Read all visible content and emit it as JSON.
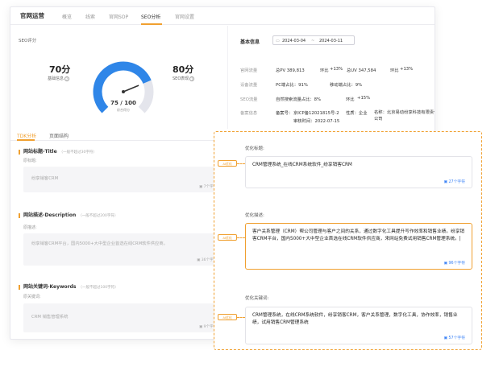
{
  "nav": {
    "brand": "官网运营",
    "tabs": [
      "概览",
      "线索",
      "官网SOP",
      "SEO分析",
      "官网设置"
    ]
  },
  "seo_score": {
    "section_label": "SEO评分",
    "basic_score": "70分",
    "basic_label": "基础信息",
    "gauge_value": "75 / 100",
    "gauge_sub": "综合得分",
    "gauge_fraction": 0.75,
    "seo_score": "80分",
    "seo_label": "SEO表现"
  },
  "basic_info": {
    "header": "基本信息",
    "date_start": "2024-03-04",
    "date_sep": "~",
    "date_end": "2024-03-11",
    "rows": {
      "traffic": {
        "key": "官网流量",
        "pv": "总PV 389,813",
        "pv_chg_lbl": "环比",
        "pv_chg": "+13%",
        "uv": "总UV 347,584",
        "uv_chg_lbl": "环比",
        "uv_chg": "+13%"
      },
      "device": {
        "key": "设备流量",
        "pc": "PC端占比：91%",
        "mobile": "移动端占比：9%"
      },
      "seo": {
        "key": "SEO流量",
        "natural": "自然搜索流量占比：8%",
        "chg_lbl": "环比",
        "chg": "+15%"
      },
      "icp": {
        "key": "备案信息",
        "no_lbl": "备案号：",
        "no": "京ICP备12021815号-2",
        "nature": "性质：企业",
        "name": "名称：北京易动纷享科技有限责任公司",
        "date": "审核时间：2022-07-15"
      }
    }
  },
  "tabs2": [
    "TDK分析",
    "页面结构"
  ],
  "fields": {
    "title": {
      "label": "网站标题-Title",
      "hint": "（一般不超过30字符）",
      "sub": "原标题:",
      "value": "纷享销客CRM",
      "count": "7个字符"
    },
    "desc": {
      "label": "网站描述-Description",
      "hint": "（一般不超过200字符）",
      "sub": "原描述:",
      "value": "纷享销客CRM平台，国内5000+大中型企业首选在线CRM软件供应商。",
      "count": "36个字符"
    },
    "keywords": {
      "label": "网站关键词-Keywords",
      "hint": "（一般不超过100字符）",
      "sub": "原关键词:",
      "value": "CRM 销售管理系统",
      "count": "9个字符"
    }
  },
  "optimized": {
    "tag": "AI优化",
    "title": {
      "label": "优化标题:",
      "value": "CRM管理系统_在线CRM系统软件_纷享销客CRM",
      "count": "27个字符"
    },
    "desc": {
      "label": "优化描述:",
      "value": "客户关系管理（CRM）帮公司管理与客户之间的关系，通过数字化工具提升写作效率和销售业绩。纷享销客CRM平台，国内5000+大中型企业首选在线CRM软件供应商，来网站免费试用销售CRM管理系统。|",
      "count": "96个字符"
    },
    "keywords": {
      "label": "优化关键词:",
      "value": "CRM管理系统，在线CRM系统软件，纷享销客CRM，客户关系管理，数字化工具，协作效率，销售业绩，试用销售CRM管理系统",
      "count": "57个字符"
    }
  },
  "colors": {
    "accent": "#f0a030",
    "gauge_blue": "#2f86e8",
    "green": "#35b35b",
    "link": "#3b82f6"
  }
}
